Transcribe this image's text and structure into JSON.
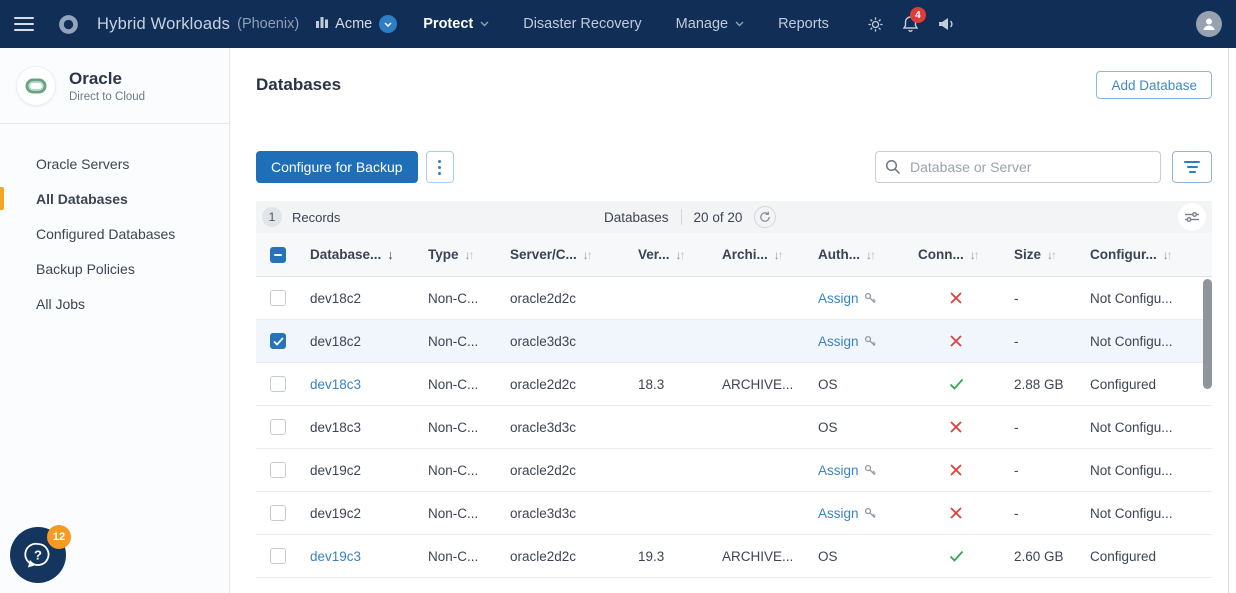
{
  "navbar": {
    "title": "Hybrid Workloads",
    "subtitle": "(Phoenix)",
    "org": "Acme",
    "notification_count": "4",
    "menu": [
      {
        "label": "Protect",
        "caret": true,
        "active": true
      },
      {
        "label": "Disaster Recovery",
        "caret": false,
        "active": false
      },
      {
        "label": "Manage",
        "caret": true,
        "active": false
      },
      {
        "label": "Reports",
        "caret": false,
        "active": false
      }
    ]
  },
  "sidebar": {
    "app_title": "Oracle",
    "app_subtitle": "Direct to Cloud",
    "items": [
      {
        "label": "Oracle Servers",
        "active": false
      },
      {
        "label": "All Databases",
        "active": true
      },
      {
        "label": "Configured Databases",
        "active": false
      },
      {
        "label": "Backup Policies",
        "active": false
      },
      {
        "label": "All Jobs",
        "active": false
      }
    ],
    "help_badge": "12"
  },
  "main": {
    "page_title": "Databases",
    "add_button_label": "Add Database",
    "toolbar": {
      "configure_button_label": "Configure for Backup",
      "search_placeholder": "Database or Server"
    },
    "records_bar": {
      "count_badge": "1",
      "count_label": "Records",
      "entity_label": "Databases",
      "range_label": "20 of 20"
    },
    "table": {
      "header_checkbox": "indeterminate",
      "columns": [
        {
          "label": "Database...",
          "sort": "desc"
        },
        {
          "label": "Type",
          "sort": "both"
        },
        {
          "label": "Server/C...",
          "sort": "both"
        },
        {
          "label": "Ver...",
          "sort": "both"
        },
        {
          "label": "Archi...",
          "sort": "both"
        },
        {
          "label": "Auth...",
          "sort": "both"
        },
        {
          "label": "Conn...",
          "sort": "both"
        },
        {
          "label": "Size",
          "sort": "both"
        },
        {
          "label": "Configur...",
          "sort": "both"
        }
      ],
      "rows": [
        {
          "checked": false,
          "selected": false,
          "database": "dev18c2",
          "database_is_link": false,
          "type": "Non-C...",
          "server": "oracle2d2c",
          "version": "",
          "archive_log": "",
          "auth": "Assign",
          "auth_is_link": true,
          "connection": "error",
          "size": "-",
          "configuration": "Not Configu..."
        },
        {
          "checked": true,
          "selected": true,
          "database": "dev18c2",
          "database_is_link": false,
          "type": "Non-C...",
          "server": "oracle3d3c",
          "version": "",
          "archive_log": "",
          "auth": "Assign",
          "auth_is_link": true,
          "connection": "error",
          "size": "-",
          "configuration": "Not Configu..."
        },
        {
          "checked": false,
          "selected": false,
          "database": "dev18c3",
          "database_is_link": true,
          "type": "Non-C...",
          "server": "oracle2d2c",
          "version": "18.3",
          "archive_log": "ARCHIVE...",
          "auth": "OS",
          "auth_is_link": false,
          "connection": "ok",
          "size": "2.88 GB",
          "configuration": "Configured"
        },
        {
          "checked": false,
          "selected": false,
          "database": "dev18c3",
          "database_is_link": false,
          "type": "Non-C...",
          "server": "oracle3d3c",
          "version": "",
          "archive_log": "",
          "auth": "OS",
          "auth_is_link": false,
          "connection": "error",
          "size": "-",
          "configuration": "Not Configu..."
        },
        {
          "checked": false,
          "selected": false,
          "database": "dev19c2",
          "database_is_link": false,
          "type": "Non-C...",
          "server": "oracle2d2c",
          "version": "",
          "archive_log": "",
          "auth": "Assign",
          "auth_is_link": true,
          "connection": "error",
          "size": "-",
          "configuration": "Not Configu..."
        },
        {
          "checked": false,
          "selected": false,
          "database": "dev19c2",
          "database_is_link": false,
          "type": "Non-C...",
          "server": "oracle3d3c",
          "version": "",
          "archive_log": "",
          "auth": "Assign",
          "auth_is_link": true,
          "connection": "error",
          "size": "-",
          "configuration": "Not Configu..."
        },
        {
          "checked": false,
          "selected": false,
          "database": "dev19c3",
          "database_is_link": true,
          "type": "Non-C...",
          "server": "oracle2d2c",
          "version": "19.3",
          "archive_log": "ARCHIVE...",
          "auth": "OS",
          "auth_is_link": false,
          "connection": "ok",
          "size": "2.60 GB",
          "configuration": "Configured"
        }
      ]
    }
  },
  "colors": {
    "navbar_bg": "#112e56",
    "primary_button": "#1e6fb8",
    "link": "#3a82c4",
    "error": "#e23b3b",
    "success": "#2ba84a",
    "active_indicator": "#f5a623",
    "help_badge": "#f59a23",
    "notification_badge": "#e03c3c",
    "selected_row": "#f0f6fb"
  }
}
